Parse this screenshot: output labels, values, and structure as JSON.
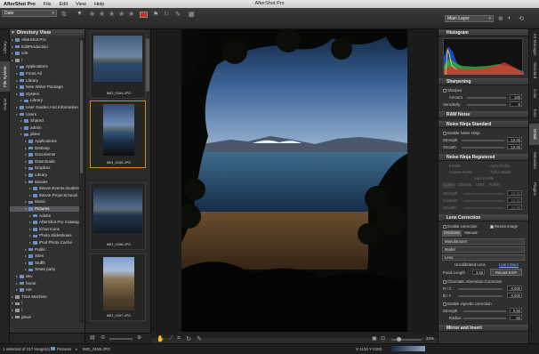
{
  "menubar": {
    "app": "AfterShot Pro",
    "items": [
      "File",
      "Edit",
      "View",
      "Help"
    ],
    "title": "AfterShot Pro"
  },
  "toolbar": {
    "sort_value": "Date",
    "layer_value": "Main Layer",
    "icons": [
      "filter-icon",
      "star-icon",
      "flag-icon",
      "tag-icon"
    ]
  },
  "left_tabs": [
    "Library",
    "File System",
    "Output"
  ],
  "directory": {
    "title": "Directory View",
    "items": [
      {
        "label": "AfterShot Pro",
        "indent": 0,
        "type": "folder"
      },
      {
        "label": "EditProduction",
        "indent": 0,
        "type": "folder"
      },
      {
        "label": "cde",
        "indent": 0,
        "type": "folder"
      },
      {
        "label": "/",
        "indent": 0,
        "type": "drive"
      },
      {
        "label": "Applications",
        "indent": 1,
        "type": "folder"
      },
      {
        "label": "Fonts All",
        "indent": 1,
        "type": "folder"
      },
      {
        "label": "Library",
        "indent": 1,
        "type": "folder"
      },
      {
        "label": "New Writer Package",
        "indent": 1,
        "type": "folder"
      },
      {
        "label": "System",
        "indent": 1,
        "type": "folder"
      },
      {
        "label": "Library",
        "indent": 2,
        "type": "folder"
      },
      {
        "label": "User Guides And Information",
        "indent": 1,
        "type": "folder"
      },
      {
        "label": "Users",
        "indent": 1,
        "type": "folder"
      },
      {
        "label": "Shared",
        "indent": 2,
        "type": "folder"
      },
      {
        "label": "admin",
        "indent": 2,
        "type": "folder"
      },
      {
        "label": "jdove",
        "indent": 2,
        "type": "folder"
      },
      {
        "label": "Applications",
        "indent": 3,
        "type": "folder"
      },
      {
        "label": "Desktop",
        "indent": 3,
        "type": "folder"
      },
      {
        "label": "Documents",
        "indent": 3,
        "type": "folder"
      },
      {
        "label": "Downloads",
        "indent": 3,
        "type": "folder"
      },
      {
        "label": "Dropbox",
        "indent": 3,
        "type": "folder"
      },
      {
        "label": "Library",
        "indent": 3,
        "type": "folder"
      },
      {
        "label": "Movies",
        "indent": 3,
        "type": "folder"
      },
      {
        "label": "iMovie Events.localize",
        "indent": 4,
        "type": "folder"
      },
      {
        "label": "iMovie Projects.locali",
        "indent": 4,
        "type": "folder"
      },
      {
        "label": "Music",
        "indent": 3,
        "type": "folder"
      },
      {
        "label": "Pictures",
        "indent": 3,
        "type": "folder",
        "selected": true
      },
      {
        "label": "Adobe",
        "indent": 4,
        "type": "folder"
      },
      {
        "label": "AfterShot Pro Catalog",
        "indent": 4,
        "type": "folder"
      },
      {
        "label": "iChat Icons",
        "indent": 4,
        "type": "folder"
      },
      {
        "label": "Photo Slideshows",
        "indent": 4,
        "type": "folder"
      },
      {
        "label": "iPod Photo Cache",
        "indent": 4,
        "type": "folder"
      },
      {
        "label": "Public",
        "indent": 3,
        "type": "folder"
      },
      {
        "label": "Sites",
        "indent": 3,
        "type": "folder"
      },
      {
        "label": "Stuffit",
        "indent": 3,
        "type": "folder"
      },
      {
        "label": "Xmas party",
        "indent": 3,
        "type": "folder"
      },
      {
        "label": "dev",
        "indent": 1,
        "type": "folder"
      },
      {
        "label": "home",
        "indent": 1,
        "type": "folder"
      },
      {
        "label": "net",
        "indent": 1,
        "type": "folder"
      },
      {
        "label": "Time Machine",
        "indent": 0,
        "type": "drive"
      },
      {
        "label": "/",
        "indent": 0,
        "type": "drive"
      },
      {
        "label": "/",
        "indent": 0,
        "type": "drive"
      },
      {
        "label": "jdove",
        "indent": 0,
        "type": "drive"
      }
    ]
  },
  "thumbnails": [
    {
      "caption": "IMG_0154.JPG",
      "selected": false
    },
    {
      "caption": "IMG_0155.JPG",
      "selected": true
    },
    {
      "caption": "IMG_0156.JPG",
      "selected": false
    },
    {
      "caption": "IMG_0157.JPG",
      "selected": false
    }
  ],
  "viewer": {
    "zoom": "33%"
  },
  "status": {
    "selection": "1 selected of 217 image(s)",
    "folder": "Pictures",
    "filename": "IMG_0155.JPG",
    "coords": "X 1134  Y 0183"
  },
  "right_tabs": [
    "IIS Manager",
    "Standard",
    "Color",
    "Tone",
    "Detail",
    "Metadata",
    "Plugins"
  ],
  "right_active_tab": "Detail",
  "panel": {
    "histogram": "Histogram",
    "sharpening": {
      "title": "Sharpening",
      "enable": "Sharpen",
      "amount_label": "Amount",
      "amount": "100",
      "sens_label": "Sensitivity",
      "sens": "6"
    },
    "rawnoise": {
      "title": "RAW Noise"
    },
    "nns": {
      "title": "Noise Ninja Standard",
      "enable": "Enable Noise Ninja",
      "strength_label": "Strength",
      "strength": "10.00",
      "smooth_label": "Smooth",
      "smooth": "10.00"
    },
    "nnr": {
      "title": "Noise Ninja Registered",
      "enable": "Enable",
      "auto": "Auto Profile",
      "coarse": "Coarse Noise",
      "turbo": "Turbo Mode",
      "auto2": "Auto Profile",
      "tabs": [
        "Luma",
        "Chroma",
        "USM",
        "Profile"
      ],
      "strength_label": "Strength",
      "strength": "10.00",
      "contrast_label": "Contrast",
      "contrast": "10.00",
      "smooth_label": "Smooth",
      "smooth": "10.00"
    },
    "lens": {
      "title": "Lens Correction",
      "enable": "Enable correction",
      "resize": "Resize image",
      "tabs": [
        "Database",
        "Manual"
      ],
      "manufacturer": "Manufacturer",
      "model": "Model",
      "lens": "Lens",
      "uncal": "Uncalibrated Lens",
      "link": "Learn More",
      "focal_label": "Focal Length",
      "focal": "3.85",
      "reload": "Reload EXIF",
      "ca": "Chromatic Aberration Correction",
      "rc_label": "R / C",
      "rc": "0.000",
      "by_label": "B / Y",
      "by": "0.000",
      "vig": "Enable vignette correction",
      "vstr_label": "Strength",
      "vstr": "0.50",
      "vrad_label": "Radius",
      "vrad": "50"
    },
    "mirror": {
      "title": "Mirror and Invert"
    }
  },
  "colors": {
    "accent_orange": "#d08a2a",
    "folder_blue": "#6c8fc7",
    "flag_red": "#c8302c"
  }
}
